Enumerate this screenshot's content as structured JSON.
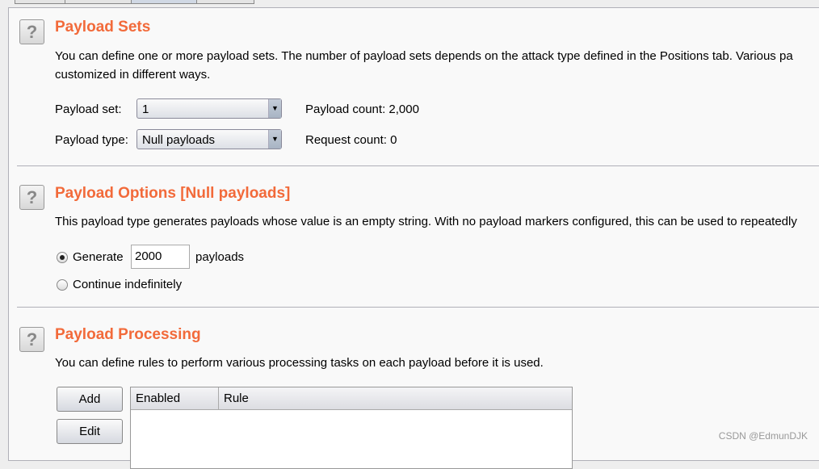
{
  "payload_sets": {
    "title": "Payload Sets",
    "description_line1": "You can define one or more payload sets. The number of payload sets depends on the attack type defined in the Positions tab. Various pa",
    "description_line2": "customized in different ways.",
    "set_label": "Payload set:",
    "set_value": "1",
    "type_label": "Payload type:",
    "type_value": "Null payloads",
    "payload_count": "Payload count:  2,000",
    "request_count": "Request count:  0"
  },
  "payload_options": {
    "title": "Payload Options [Null payloads]",
    "description": "This payload type generates payloads whose value is an empty string. With no payload markers configured, this can be used to repeatedly",
    "generate_label": "Generate",
    "generate_value": "2000",
    "payloads_suffix": "payloads",
    "continue_label": "Continue indefinitely",
    "selected": "generate"
  },
  "payload_processing": {
    "title": "Payload Processing",
    "description": "You can define rules to perform various processing tasks on each payload before it is used.",
    "add_label": "Add",
    "edit_label": "Edit",
    "columns": [
      "Enabled",
      "Rule"
    ]
  },
  "help_glyph": "?",
  "watermark": "CSDN @EdmunDJK"
}
